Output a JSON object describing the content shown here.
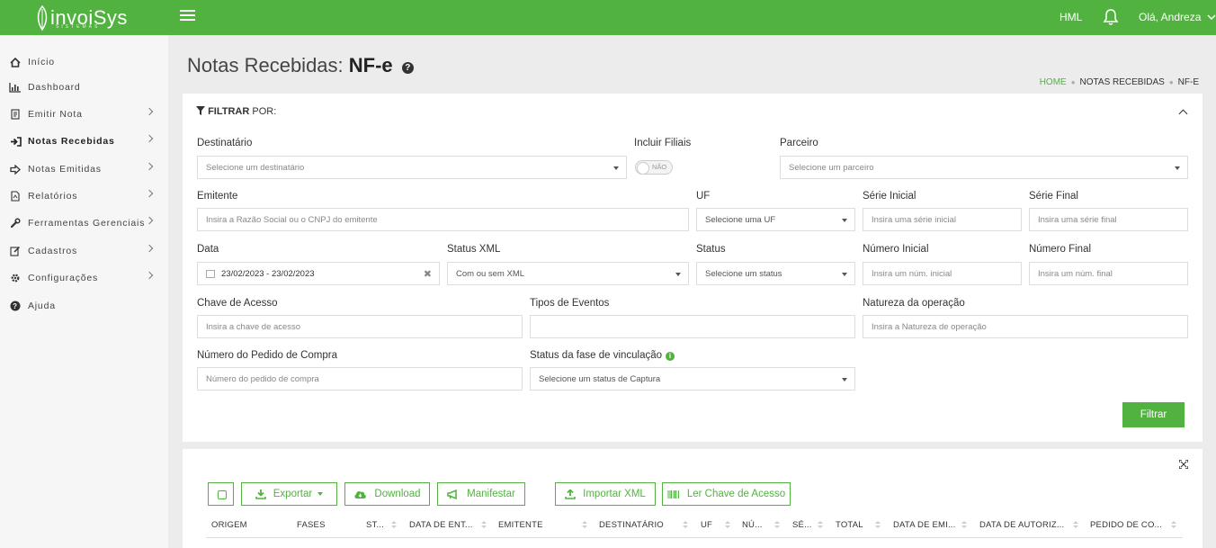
{
  "header": {
    "logo_text": "invoiSys",
    "logo_sub": "SISTEMAS",
    "env": "HML",
    "user": "Olá, Andreza"
  },
  "sidebar": {
    "items": [
      {
        "label": "Início",
        "icon": "home-icon"
      },
      {
        "label": "Dashboard",
        "icon": "bar-chart-icon"
      },
      {
        "label": "Emitir Nota",
        "icon": "document-icon"
      },
      {
        "label": "Notas Recebidas",
        "icon": "sign-in-icon"
      },
      {
        "label": "Notas Emitidas",
        "icon": "arrow-out-icon"
      },
      {
        "label": "Relatórios",
        "icon": "report-icon"
      },
      {
        "label": "Ferramentas Gerenciais",
        "icon": "wrench-icon"
      },
      {
        "label": "Cadastros",
        "icon": "edit-icon"
      },
      {
        "label": "Configurações",
        "icon": "gear-icon"
      },
      {
        "label": "Ajuda",
        "icon": "question-icon"
      }
    ]
  },
  "page": {
    "title_prefix": "Notas Recebidas:",
    "title_bold": "NF-e",
    "breadcrumb": [
      "HOME",
      "NOTAS RECEBIDAS",
      "NF-E"
    ]
  },
  "filter": {
    "title_bold": "FILTRAR",
    "title_rest": "POR:",
    "destinatario": {
      "label": "Destinatário",
      "placeholder": "Selecione um destinatário"
    },
    "incluir_filiais": {
      "label": "Incluir Filiais",
      "value": "NÃO"
    },
    "parceiro": {
      "label": "Parceiro",
      "placeholder": "Selecione um parceiro"
    },
    "emitente": {
      "label": "Emitente",
      "placeholder": "Insira a Razão Social ou o CNPJ do emitente"
    },
    "uf": {
      "label": "UF",
      "placeholder": "Selecione uma UF"
    },
    "serie_inicial": {
      "label": "Série Inicial",
      "placeholder": "Insira uma série inicial"
    },
    "serie_final": {
      "label": "Série Final",
      "placeholder": "Insira uma série final"
    },
    "data": {
      "label": "Data",
      "value": "23/02/2023 - 23/02/2023"
    },
    "status_xml": {
      "label": "Status XML",
      "value": "Com ou sem XML"
    },
    "status": {
      "label": "Status",
      "placeholder": "Selecione um status"
    },
    "numero_inicial": {
      "label": "Número Inicial",
      "placeholder": "Insira um núm. inicial"
    },
    "numero_final": {
      "label": "Número Final",
      "placeholder": "Insira um núm. final"
    },
    "chave": {
      "label": "Chave de Acesso",
      "placeholder": "Insira a chave de acesso"
    },
    "tipos_eventos": {
      "label": "Tipos de Eventos",
      "placeholder": ""
    },
    "natureza": {
      "label": "Natureza da operação",
      "placeholder": "Insira a Natureza de operação"
    },
    "pedido": {
      "label": "Número do Pedido de Compra",
      "placeholder": "Número do pedido de compra"
    },
    "status_fase": {
      "label": "Status da fase de vinculação",
      "placeholder": "Selecione um status de Captura"
    },
    "button": "Filtrar"
  },
  "toolbar": {
    "exportar": "Exportar",
    "download": "Download",
    "manifestar": "Manifestar",
    "importar": "Importar XML",
    "ler_chave": "Ler Chave de Acesso"
  },
  "table": {
    "columns": [
      "ORIGEM",
      "FASES",
      "ST...",
      "DATA DE ENT...",
      "EMITENTE",
      "DESTINATÁRIO",
      "UF",
      "NÚ...",
      "SÉ...",
      "TOTAL",
      "DATA DE EMI...",
      "DATA DE AUTORIZ...",
      "PEDIDO DE CO..."
    ]
  },
  "colors": {
    "brand": "#52b240"
  }
}
